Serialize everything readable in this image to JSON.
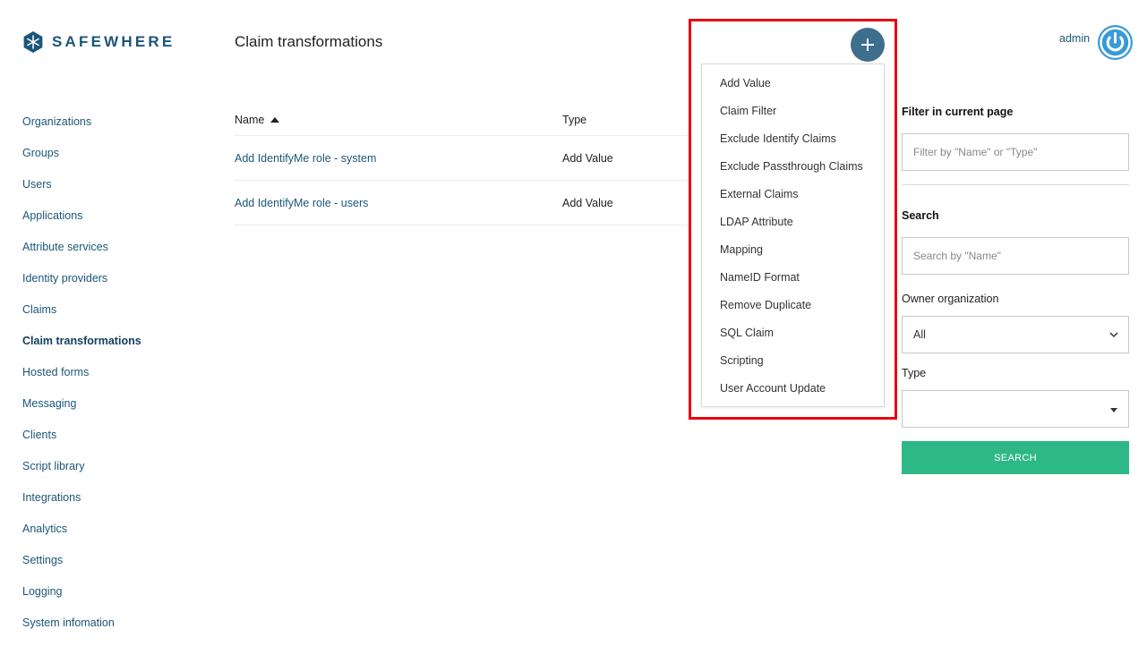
{
  "brand": {
    "name": "SAFEWHERE"
  },
  "header": {
    "title": "Claim transformations"
  },
  "user": {
    "name": "admin"
  },
  "sidebar": {
    "items": [
      {
        "label": "Organizations"
      },
      {
        "label": "Groups"
      },
      {
        "label": "Users"
      },
      {
        "label": "Applications"
      },
      {
        "label": "Attribute services"
      },
      {
        "label": "Identity providers"
      },
      {
        "label": "Claims"
      },
      {
        "label": "Claim transformations",
        "active": true
      },
      {
        "label": "Hosted forms"
      },
      {
        "label": "Messaging"
      },
      {
        "label": "Clients"
      },
      {
        "label": "Script library"
      },
      {
        "label": "Integrations"
      },
      {
        "label": "Analytics"
      },
      {
        "label": "Settings"
      },
      {
        "label": "Logging"
      },
      {
        "label": "System infomation"
      }
    ]
  },
  "table": {
    "columns": {
      "name": "Name",
      "type": "Type"
    },
    "rows": [
      {
        "name": "Add IdentifyMe role - system",
        "type": "Add Value"
      },
      {
        "name": "Add IdentifyMe role - users",
        "type": "Add Value"
      }
    ]
  },
  "add_menu": {
    "items": [
      "Add Value",
      "Claim Filter",
      "Exclude Identify Claims",
      "Exclude Passthrough Claims",
      "External Claims",
      "LDAP Attribute",
      "Mapping",
      "NameID Format",
      "Remove Duplicate",
      "SQL Claim",
      "Scripting",
      "User Account Update"
    ]
  },
  "filter_panel": {
    "filter_heading": "Filter in current page",
    "filter_placeholder": "Filter by \"Name\" or \"Type\"",
    "search_heading": "Search",
    "search_placeholder": "Search by \"Name\"",
    "owner_label": "Owner organization",
    "owner_value": "All",
    "type_label": "Type",
    "type_value": "",
    "search_button": "SEARCH"
  },
  "colors": {
    "brand": "#1d5678",
    "add_button": "#3e6e8e",
    "power_icon": "#3a9ad6",
    "search_button": "#2eb887",
    "highlight": "#e30613"
  }
}
